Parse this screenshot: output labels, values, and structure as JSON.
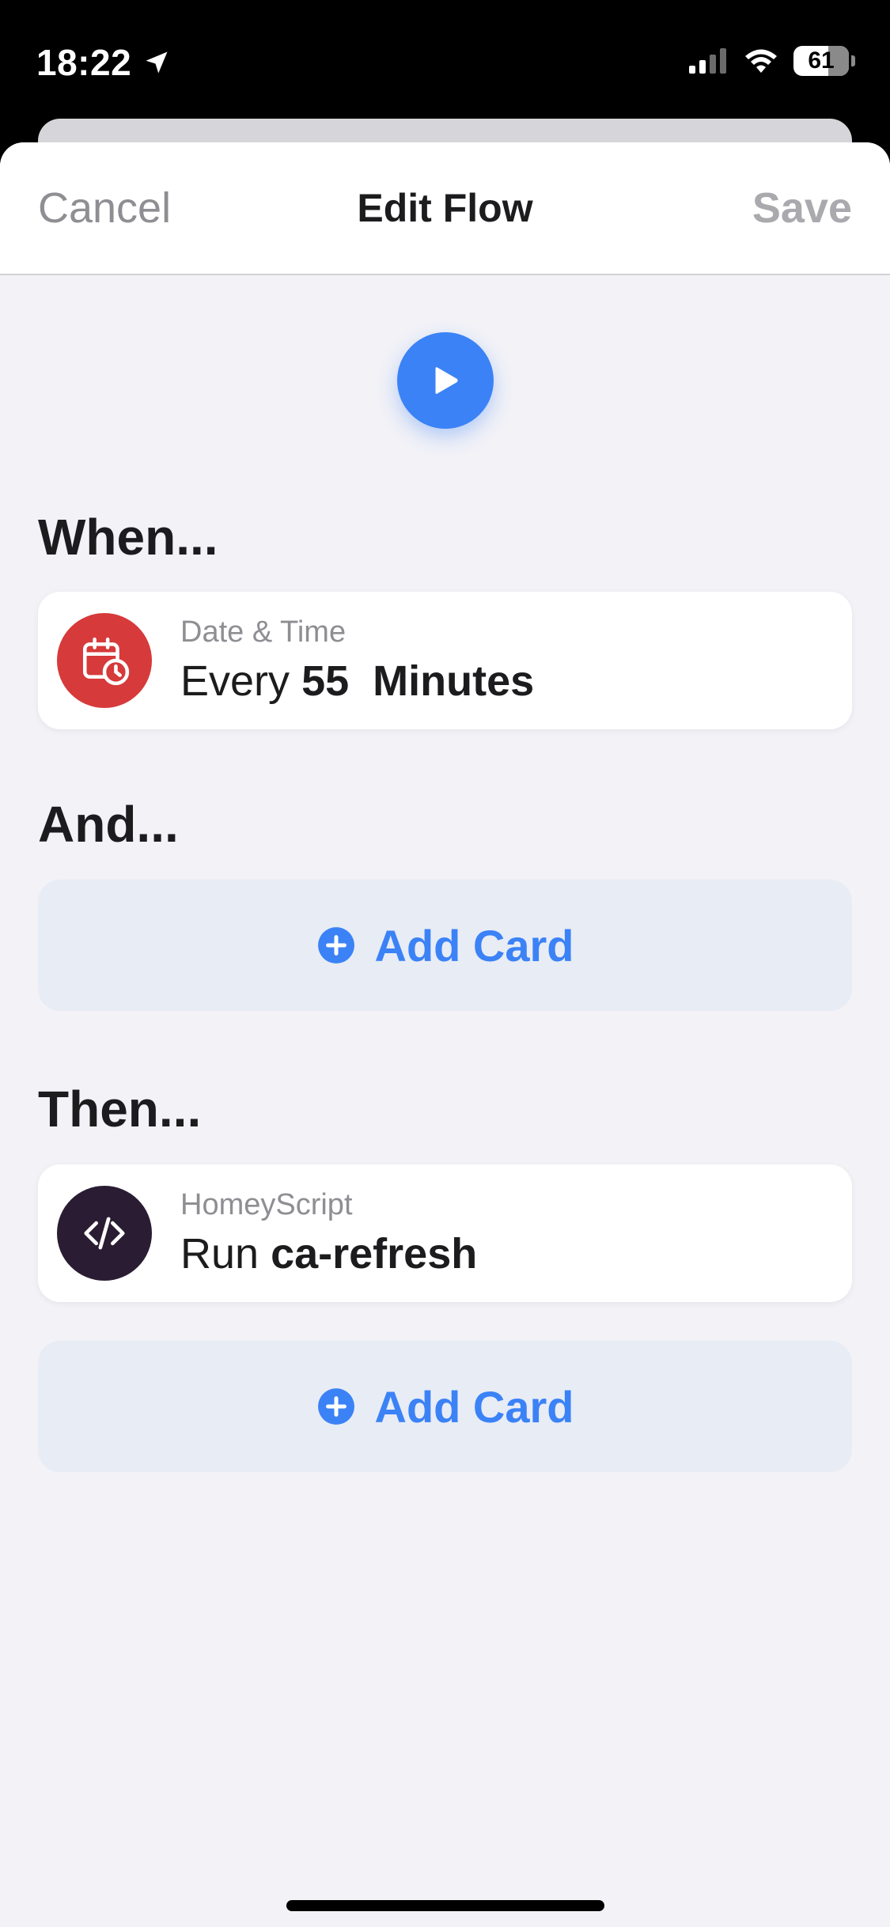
{
  "status_bar": {
    "time": "18:22",
    "battery": "61"
  },
  "nav": {
    "cancel": "Cancel",
    "title": "Edit Flow",
    "save": "Save"
  },
  "sections": {
    "when": "When...",
    "and": "And...",
    "then": "Then..."
  },
  "when_card": {
    "category": "Date & Time",
    "text_prefix": "Every",
    "value": "55",
    "unit": "Minutes",
    "icon": "calendar-clock-icon",
    "icon_color": "#d63a3a"
  },
  "then_card": {
    "category": "HomeyScript",
    "text_prefix": "Run",
    "value": "ca-refresh",
    "icon": "code-icon",
    "icon_color": "#2a1d33"
  },
  "add_card_label": "Add Card",
  "colors": {
    "accent": "#3b82f6",
    "background": "#f2f2f7",
    "add_card_bg": "#e8ecf5"
  }
}
